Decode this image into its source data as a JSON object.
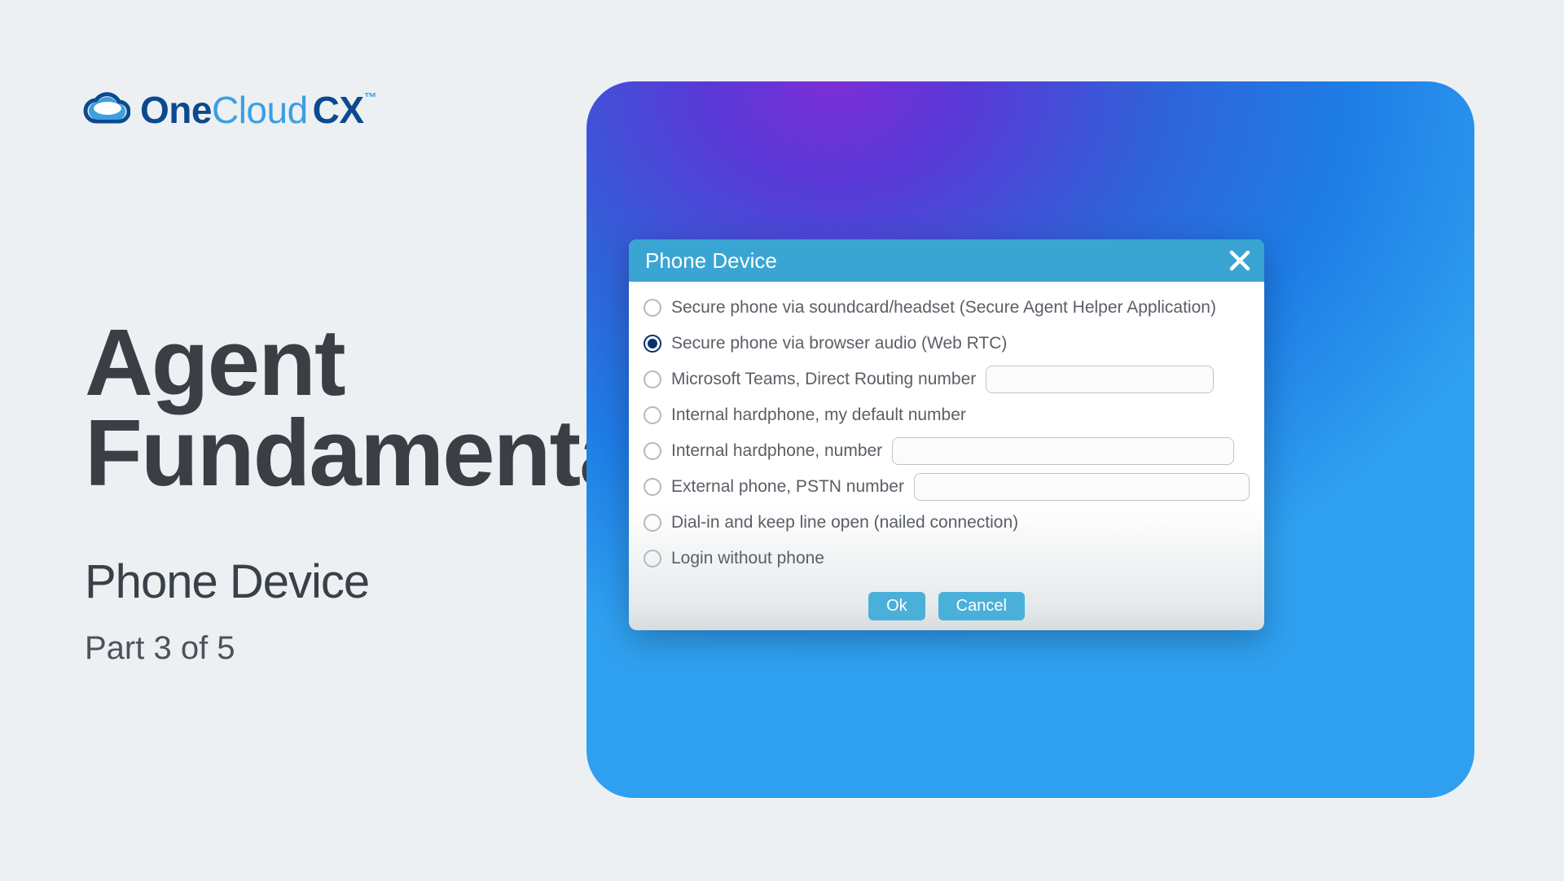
{
  "brand": {
    "one": "One",
    "cloud": "Cloud",
    "cx": "CX",
    "tm": "™"
  },
  "page": {
    "title_line1": "Agent",
    "title_line2": "Fundamentals",
    "subtitle": "Phone Device",
    "part": "Part 3 of 5"
  },
  "dialog": {
    "title": "Phone Device",
    "options": [
      {
        "label": "Secure phone via soundcard/headset (Secure Agent Helper Application)",
        "selected": false,
        "has_input": false
      },
      {
        "label": "Secure phone via browser audio (Web RTC)",
        "selected": true,
        "has_input": false
      },
      {
        "label": "Microsoft Teams, Direct Routing number",
        "selected": false,
        "has_input": true,
        "input_value": ""
      },
      {
        "label": "Internal hardphone, my default number",
        "selected": false,
        "has_input": false
      },
      {
        "label": "Internal hardphone, number",
        "selected": false,
        "has_input": true,
        "input_value": "",
        "wide": true
      },
      {
        "label": "External phone, PSTN number",
        "selected": false,
        "has_input": true,
        "input_value": "",
        "wide": true
      },
      {
        "label": "Dial-in and keep line open (nailed connection)",
        "selected": false,
        "has_input": false
      },
      {
        "label": "Login without phone",
        "selected": false,
        "has_input": false
      }
    ],
    "ok_label": "Ok",
    "cancel_label": "Cancel"
  }
}
